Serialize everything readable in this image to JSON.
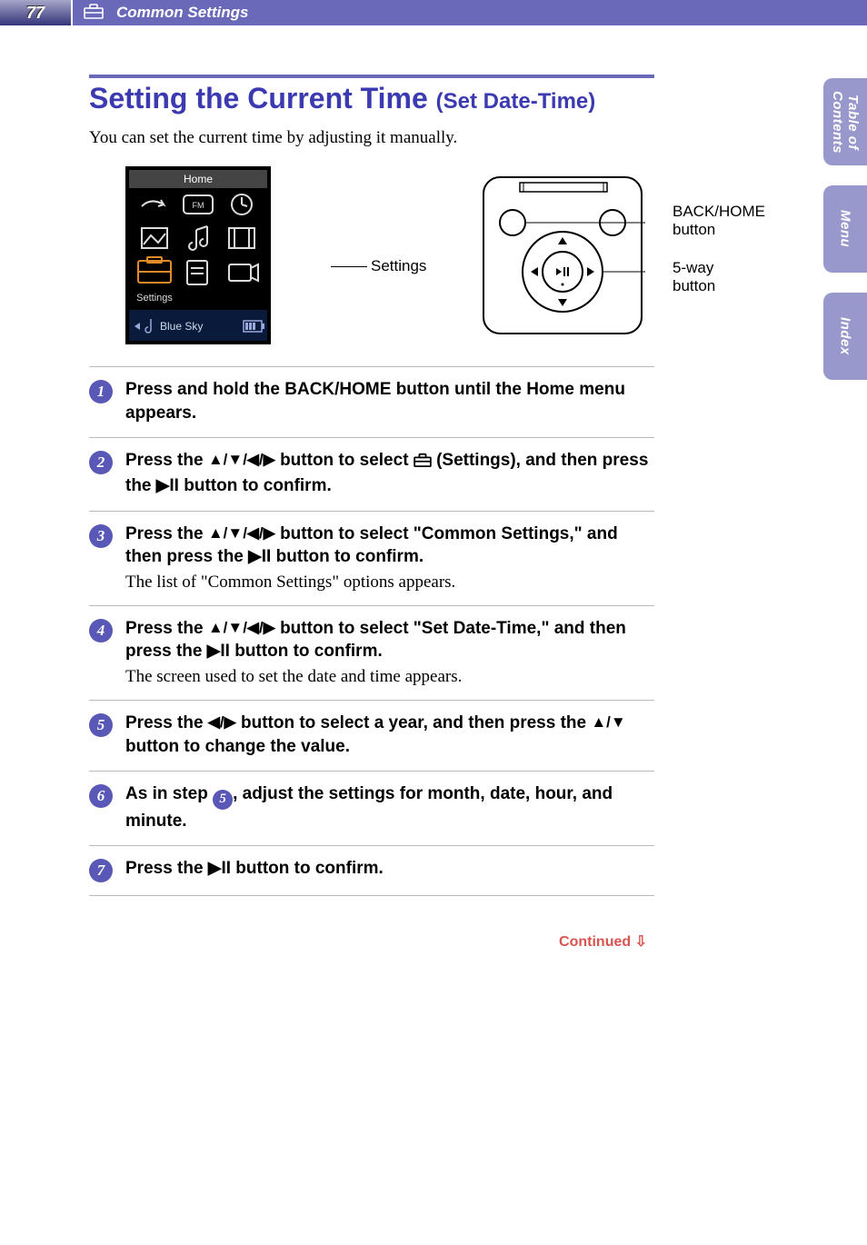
{
  "header": {
    "page_number": "77",
    "section": "Common Settings"
  },
  "side_nav": {
    "toc": "Table of Contents",
    "menu": "Menu",
    "index": "Index"
  },
  "title_main": "Setting the Current Time",
  "title_sub": "(Set Date-Time)",
  "intro": "You can set the current time by adjusting it manually.",
  "diagram": {
    "screen_callout": "Settings",
    "screen_title": "Home",
    "screen_footer_icon_caption": "Settings",
    "now_playing": "Blue Sky",
    "body_callout_back": "BACK/HOME button",
    "body_callout_5way": "5-way button"
  },
  "steps": {
    "s1": {
      "num": "1",
      "bold": "Press and hold the BACK/HOME button until the Home menu appears."
    },
    "s2": {
      "num": "2",
      "bold_a": "Press the ",
      "bold_b": " button to select ",
      "bold_c": " (Settings), and then press the ",
      "bold_d": " button to confirm."
    },
    "s3": {
      "num": "3",
      "bold_a": "Press the ",
      "bold_b": " button to select \"Common Settings,\" and then press the ",
      "bold_c": " button to confirm.",
      "plain": "The list of \"Common Settings\" options appears."
    },
    "s4": {
      "num": "4",
      "bold_a": "Press the ",
      "bold_b": " button to select \"Set Date-Time,\" and then press the ",
      "bold_c": " button to confirm.",
      "plain": "The screen used to set the date and time appears."
    },
    "s5": {
      "num": "5",
      "bold_a": "Press the ",
      "bold_b": " button to select a year, and then press the ",
      "bold_c": " button to change the value."
    },
    "s6": {
      "num": "6",
      "bold_a": "As in step ",
      "ref": "5",
      "bold_b": ", adjust the settings for month, date, hour, and minute."
    },
    "s7": {
      "num": "7",
      "bold_a": "Press the ",
      "bold_b": " button to confirm."
    }
  },
  "continued": "Continued"
}
